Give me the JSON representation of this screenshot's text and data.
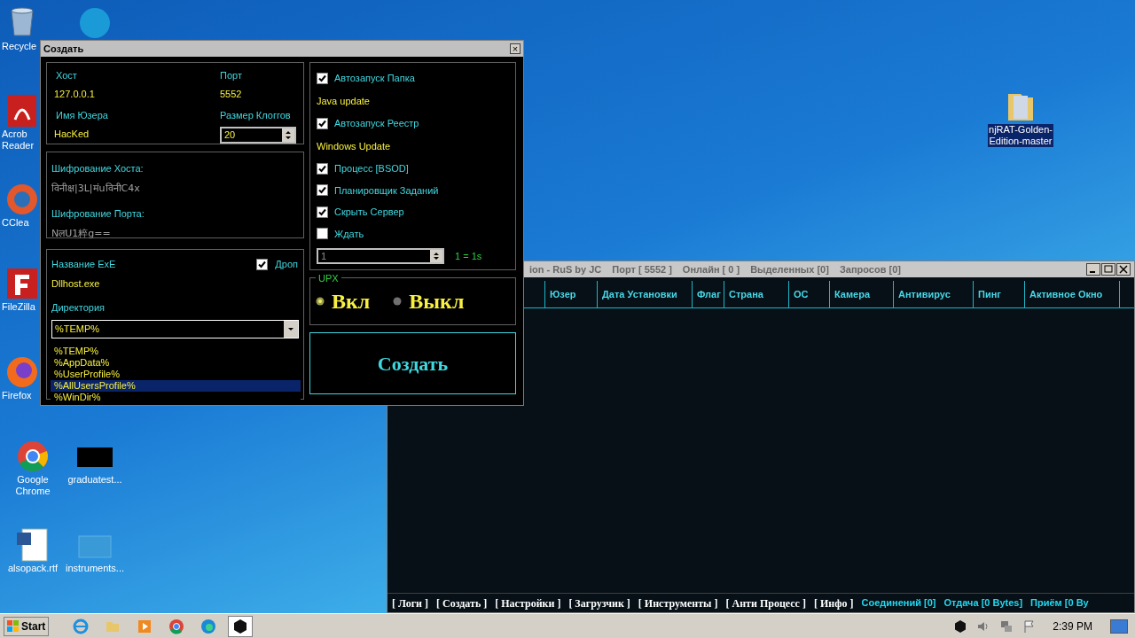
{
  "desktop_icons": [
    {
      "kind": "trash",
      "lines": [
        "Recycle"
      ],
      "selected": false
    },
    {
      "kind": "skype",
      "selected": false
    },
    {
      "kind": "pdf",
      "lines": [
        "Acrob",
        "Reader"
      ],
      "selected": false
    },
    {
      "kind": "ccleaner",
      "lines": [
        "CClea"
      ],
      "selected": false
    },
    {
      "kind": "filezilla",
      "lines": [
        "FileZilla"
      ],
      "selected": false
    },
    {
      "kind": "firefox",
      "lines": [
        "Firefox"
      ],
      "selected": false
    },
    {
      "kind": "chrome",
      "lines": [
        "Google",
        "Chrome"
      ],
      "selected": false
    },
    {
      "kind": "dark-thumb",
      "lines": [
        "graduatest..."
      ],
      "selected": false
    },
    {
      "kind": "doc",
      "lines": [
        "alsopack.rtf"
      ],
      "selected": false
    },
    {
      "kind": "blank-thumb",
      "lines": [
        "instruments..."
      ],
      "selected": false
    },
    {
      "kind": "folder",
      "lines": [
        "njRAT-Golden-",
        "Edition-master"
      ],
      "selected": true
    }
  ],
  "main_window": {
    "title_parts": [
      "ion - RuS by JC",
      "Порт [ 5552 ]",
      "Онлайн [ 0 ]",
      "Выделенных [0]",
      "Запросов [0]"
    ],
    "columns": [
      "Юзер",
      "Дата Установки",
      "Флаг",
      "Страна",
      "ОС",
      "Камера",
      "Антивирус",
      "Пинг",
      "Активное Окно"
    ],
    "menu": [
      "[ Логи ]",
      "[ Создать ]",
      "[ Настройки ]",
      "[ Загрузчик ]",
      "[ Инструменты ]",
      "[ Анти Процесс ]",
      "[ Инфо ]"
    ],
    "status": [
      "Соединений [0]",
      "Отдача [0 Bytes]",
      "Приём [0 By"
    ]
  },
  "dialog": {
    "title": "Создать",
    "close": "×",
    "host_label": "Хост",
    "host": "127.0.0.1",
    "port_label": "Порт",
    "port": "5552",
    "user_label": "Имя Юзера",
    "user": "HacKed",
    "log_label": "Размер Клоггов",
    "log_size": "20",
    "host_enc_label": "Шифрование Хоста:",
    "host_enc": "विनीक्ष|3L|मंuविनीC4x",
    "port_enc_label": "Шифрование Порта:",
    "port_enc": "NलU1粹g==",
    "exe_label": "Название ExE",
    "drop_label": "Дроп",
    "drop_checked": true,
    "exe": "Dllhost.exe",
    "dir_label": "Директория",
    "dir": "%TEMP%",
    "dir_options": [
      {
        "label": "%TEMP%",
        "selected": false
      },
      {
        "label": "%AppData%",
        "selected": false
      },
      {
        "label": "%UserProfile%",
        "selected": false
      },
      {
        "label": "%AllUsersProfile%",
        "selected": true
      },
      {
        "label": "%WinDir%",
        "selected": false
      }
    ],
    "options": [
      {
        "kind": "check",
        "label": "Автозапуск Папка",
        "checked": true
      },
      {
        "kind": "value",
        "label": "Java update"
      },
      {
        "kind": "check",
        "label": "Автозапуск Реестр",
        "checked": true
      },
      {
        "kind": "value",
        "label": "Windows Update"
      },
      {
        "kind": "check",
        "label": "Процесс [BSOD]",
        "checked": true
      },
      {
        "kind": "check",
        "label": "Планировщик Заданий",
        "checked": true
      },
      {
        "kind": "check",
        "label": "Скрыть Сервер",
        "checked": true
      },
      {
        "kind": "check",
        "label": "Ждать",
        "checked": false
      }
    ],
    "wait_value": "1",
    "wait_hint": "1 = 1s",
    "upx_label": "UPX",
    "upx": [
      {
        "label": "Вкл",
        "selected": true
      },
      {
        "label": "Выкл",
        "selected": false
      }
    ],
    "create": "Создать"
  },
  "taskbar": {
    "start": "Start",
    "apps": [
      {
        "kind": "ie",
        "active": false
      },
      {
        "kind": "explorer",
        "active": false
      },
      {
        "kind": "media",
        "active": false
      },
      {
        "kind": "chrome",
        "active": false
      },
      {
        "kind": "edge",
        "active": false
      },
      {
        "kind": "njrat",
        "active": true
      }
    ],
    "time": "2:39 PM"
  }
}
